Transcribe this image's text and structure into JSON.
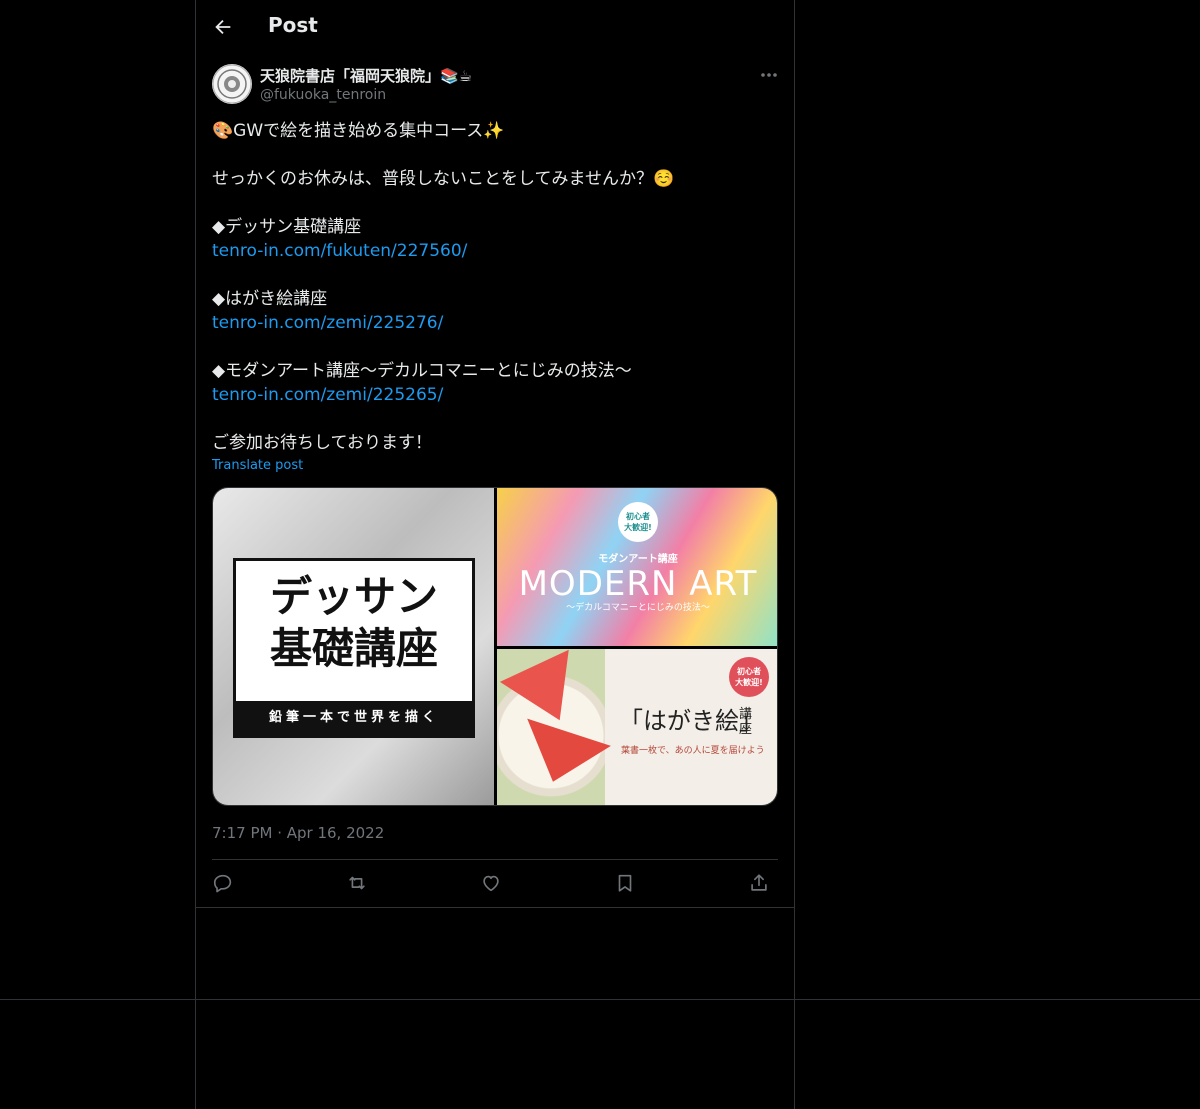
{
  "header": {
    "title": "Post"
  },
  "author": {
    "name": "天狼院書店「福岡天狼院」📚☕",
    "handle": "@fukuoka_tenroin"
  },
  "post": {
    "lines": [
      "🎨GWで絵を描き始める集中コース✨",
      "",
      "せっかくのお休みは、普段しないことをしてみませんか？☺️",
      "",
      "◆デッサン基礎講座",
      "tenro-in.com/fukuten/227560/",
      "",
      "◆はがき絵講座",
      "tenro-in.com/zemi/225276/",
      "",
      "◆モダンアート講座〜デカルコマニーとにじみの技法〜",
      "tenro-in.com/zemi/225265/",
      "",
      "ご参加お待ちしております！"
    ],
    "translate": "Translate post",
    "timestamp": "7:17 PM · Apr 16, 2022"
  },
  "media": {
    "sketch": {
      "title_line1": "デッサン",
      "title_line2": "基礎講座",
      "subtitle": "鉛筆一本で世界を描く"
    },
    "modern": {
      "badge": "初心者\n大歓迎!",
      "label": "モダンアート講座",
      "title": "MODERN ART",
      "subtitle": "〜デカルコマニーとにじみの技法〜"
    },
    "hagaki": {
      "badge": "初心者\n大歓迎!",
      "title": "「はがき絵」",
      "side": "講座",
      "subtitle": "葉書一枚で、あの人に夏を届けよう"
    }
  },
  "icons": [
    "back-arrow-icon",
    "more-icon",
    "reply-icon",
    "repost-icon",
    "like-icon",
    "bookmark-icon",
    "share-icon"
  ],
  "colors": {
    "background": "#000000",
    "text": "#e7e9ea",
    "secondary": "#71767b",
    "link": "#1d9bf0",
    "border": "#2f3336"
  }
}
